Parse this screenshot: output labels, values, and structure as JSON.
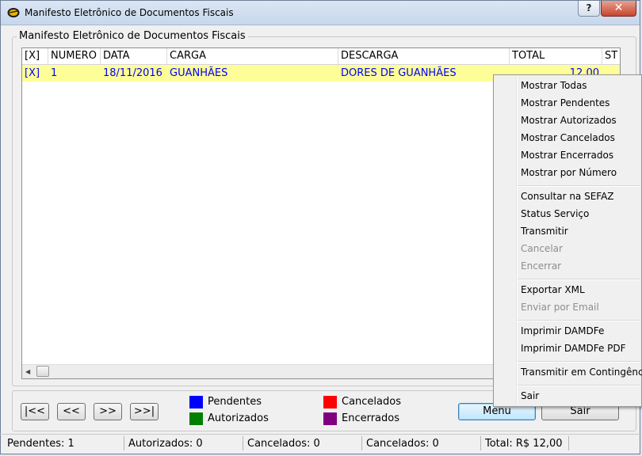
{
  "window": {
    "title": "Manifesto Eletrônico de Documentos Fiscais",
    "help_label": "?",
    "close_label": "✕"
  },
  "group_title": "Manifesto Eletrônico de Documentos Fiscais",
  "grid": {
    "columns": [
      "[X]",
      "NUMERO",
      "DATA",
      "CARGA",
      "DESCARGA",
      "TOTAL",
      "ST"
    ],
    "rows": [
      {
        "sel": "[X]",
        "numero": "1",
        "data": "18/11/2016",
        "carga": "GUANHÃES",
        "descarga": "DORES DE GUANHÃES",
        "total": "12,00"
      }
    ]
  },
  "nav": {
    "first": "|<<",
    "prev": "<<",
    "next": ">>",
    "last": ">>|"
  },
  "legend": [
    {
      "label": "Pendentes",
      "color": "#0000ff"
    },
    {
      "label": "Autorizados",
      "color": "#008000"
    },
    {
      "label": "Cancelados",
      "color": "#ff0000"
    },
    {
      "label": "Encerrados",
      "color": "#800080"
    }
  ],
  "buttons": {
    "menu": "Menu",
    "sair": "Sair"
  },
  "status": {
    "pendentes": "Pendentes: 1",
    "autorizados": "Autorizados: 0",
    "cancelados1": "Cancelados: 0",
    "cancelados2": "Cancelados: 0",
    "total": "Total: R$ 12,00"
  },
  "context_menu": {
    "items": [
      {
        "label": "Mostrar Todas",
        "enabled": true
      },
      {
        "label": "Mostrar Pendentes",
        "enabled": true
      },
      {
        "label": "Mostrar Autorizados",
        "enabled": true
      },
      {
        "label": "Mostrar Cancelados",
        "enabled": true
      },
      {
        "label": "Mostrar Encerrados",
        "enabled": true
      },
      {
        "label": "Mostrar por Número",
        "enabled": true
      },
      {
        "label": "Consultar na SEFAZ",
        "enabled": true
      },
      {
        "label": "Status Serviço",
        "enabled": true
      },
      {
        "label": "Transmitir",
        "enabled": true
      },
      {
        "label": "Cancelar",
        "enabled": false
      },
      {
        "label": "Encerrar",
        "enabled": false
      },
      {
        "label": "Exportar XML",
        "enabled": true
      },
      {
        "label": "Enviar por Email",
        "enabled": false
      },
      {
        "label": "Imprimir DAMDFe",
        "enabled": true
      },
      {
        "label": "Imprimir DAMDFe PDF",
        "enabled": true
      },
      {
        "label": "Transmitir em Contingência",
        "enabled": true
      },
      {
        "label": "Sair",
        "enabled": true
      }
    ]
  }
}
